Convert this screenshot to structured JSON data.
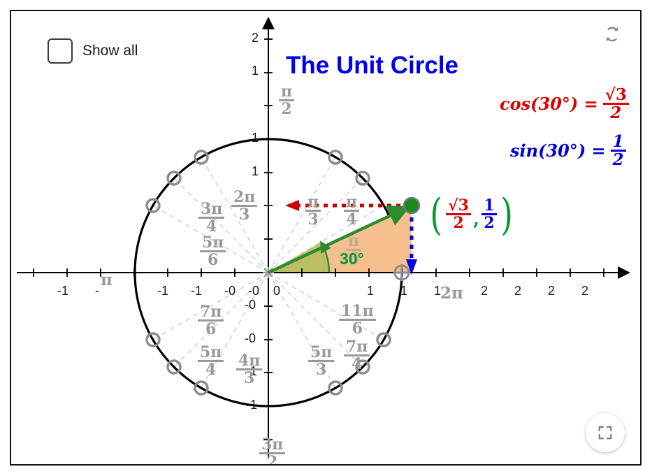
{
  "applet": {
    "title": "The Unit Circle",
    "title_color": "#0000ee"
  },
  "controls": {
    "show_all": {
      "label": "Show all",
      "checked": false
    },
    "reset_icon": "refresh-icon",
    "fullscreen_icon": "fullscreen-icon"
  },
  "equations": {
    "cos": {
      "lhs": "cos(30°) =",
      "num": "√3",
      "den": "2",
      "color": "#dd0000"
    },
    "sin": {
      "lhs": "sin(30°) =",
      "num": "1",
      "den": "2",
      "color": "#0000dd"
    }
  },
  "point_label": {
    "open": "(",
    "close": ")",
    "comma": ",",
    "x_num": "√3",
    "x_den": "2",
    "y_num": "1",
    "y_den": "2",
    "x_color": "#dd0000",
    "y_color": "#0000dd",
    "paren_color": "#009933"
  },
  "angle": {
    "degrees_label": "30°",
    "color": "#009933"
  },
  "chart_data": {
    "type": "scatter",
    "title": "The Unit Circle",
    "xlabel": "",
    "ylabel": "",
    "xlim": [
      -2.55,
      2.6
    ],
    "ylim": [
      -1.72,
      2.28
    ],
    "grid": false,
    "legend": "none",
    "circle": {
      "center": [
        0,
        0
      ],
      "radius": 1,
      "color": "#000000"
    },
    "current_point": {
      "angle_deg": 30,
      "angle_rad_label": "π/6",
      "x": 0.866,
      "y": 0.5,
      "x_label": "√3/2",
      "y_label": "1/2",
      "color": "#009933"
    },
    "marked_angles": [
      {
        "label": "π/2",
        "deg": 90,
        "x": 0,
        "y": 1
      },
      {
        "label": "2π/3",
        "deg": 120,
        "x": -0.5,
        "y": 0.866
      },
      {
        "label": "3π/4",
        "deg": 135,
        "x": -0.707,
        "y": 0.707
      },
      {
        "label": "5π/6",
        "deg": 150,
        "x": -0.866,
        "y": 0.5
      },
      {
        "label": "π",
        "deg": 180,
        "x": -1,
        "y": 0
      },
      {
        "label": "7π/6",
        "deg": 210,
        "x": -0.866,
        "y": -0.5
      },
      {
        "label": "5π/4",
        "deg": 225,
        "x": -0.707,
        "y": -0.707
      },
      {
        "label": "4π/3",
        "deg": 240,
        "x": -0.5,
        "y": -0.866
      },
      {
        "label": "3π/2",
        "deg": 270,
        "x": 0,
        "y": -1
      },
      {
        "label": "5π/3",
        "deg": 300,
        "x": 0.5,
        "y": -0.866
      },
      {
        "label": "7π/4",
        "deg": 315,
        "x": 0.707,
        "y": -0.707
      },
      {
        "label": "11π/6",
        "deg": 330,
        "x": 0.866,
        "y": -0.5
      },
      {
        "label": "2π",
        "deg": 360,
        "x": 1,
        "y": 0
      },
      {
        "label": "π/6",
        "deg": 30,
        "x": 0.866,
        "y": 0.5
      },
      {
        "label": "π/4",
        "deg": 45,
        "x": 0.707,
        "y": 0.707
      },
      {
        "label": "π/3",
        "deg": 60,
        "x": 0.5,
        "y": 0.866
      }
    ],
    "x_tick_labels": [
      "-1",
      "-",
      "-1",
      "-1",
      "-0",
      "-0",
      "0",
      "1",
      "1",
      "1",
      "2",
      "2",
      "2",
      "2"
    ],
    "y_tick_labels": [
      "2",
      "1",
      "1",
      "1",
      "-0",
      "-0",
      "-1",
      "-1"
    ],
    "vectors": {
      "radius": {
        "color": "#2d8a2d",
        "from": [
          0,
          0
        ],
        "to": [
          0.866,
          0.5
        ]
      },
      "cosine": {
        "color": "#cc0000",
        "style": "dotted",
        "from": [
          0.866,
          0.5
        ],
        "to": [
          0,
          0.5
        ]
      },
      "sine": {
        "color": "#0000ee",
        "style": "dotted",
        "from": [
          0.866,
          0.5
        ],
        "to": [
          0.866,
          0
        ]
      }
    },
    "triangle_fill": "#f5c08d"
  },
  "plot_labels": {
    "pi_half": {
      "num": "π",
      "den": "2"
    },
    "two_pi_3": {
      "num": "2π",
      "den": "3"
    },
    "three_pi_4": {
      "num": "3π",
      "den": "4"
    },
    "five_pi_6": {
      "num": "5π",
      "den": "6"
    },
    "pi": "π",
    "pi_3": {
      "num": "π",
      "den": "3"
    },
    "pi_4": {
      "num": "π",
      "den": "4"
    },
    "pi_6": {
      "num": "π",
      "den": "6"
    },
    "seven_pi_6": {
      "num": "7π",
      "den": "6"
    },
    "five_pi_4": {
      "num": "5π",
      "den": "4"
    },
    "four_pi_3": {
      "num": "4π",
      "den": "3"
    },
    "three_pi_2": {
      "num": "3π",
      "den": "2"
    },
    "five_pi_3": {
      "num": "5π",
      "den": "3"
    },
    "seven_pi_4": {
      "num": "7π",
      "den": "4"
    },
    "eleven_pi_6": {
      "num": "11π",
      "den": "6"
    },
    "two_pi": "2π"
  }
}
